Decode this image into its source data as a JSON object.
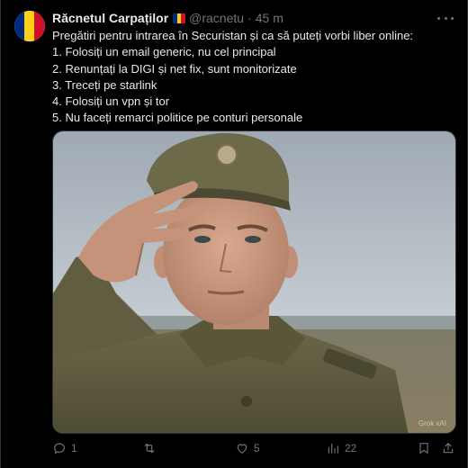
{
  "colors": {
    "flag_blue": "#002b7f",
    "flag_yellow": "#fcd116",
    "flag_red": "#ce1126",
    "text_primary": "#e7e9ea",
    "text_secondary": "#71767b",
    "background": "#000000"
  },
  "author": {
    "name": "Răcnetul Carpaților",
    "handle": "@racnetu",
    "separator": "·",
    "time": "45 m",
    "flag_icon": "romania-flag-icon"
  },
  "tweet": {
    "lines": [
      "Pregătiri pentru intrarea în Securistan și ca să puteți vorbi liber online:",
      "1. Folosiți un email generic, nu cel principal",
      "2. Renunțați la DIGI și net fix, sunt monitorizate",
      "3. Treceți pe starlink",
      "4. Folosiți un vpn și tor",
      "5. Nu faceți remarci politice pe conturi personale"
    ]
  },
  "media": {
    "watermark": "Grok xAI"
  },
  "actions": {
    "reply": {
      "icon": "reply-icon",
      "count": "1"
    },
    "repost": {
      "icon": "repost-icon",
      "count": ""
    },
    "like": {
      "icon": "like-icon",
      "count": "5"
    },
    "views": {
      "icon": "views-icon",
      "count": "22"
    },
    "bookmark": {
      "icon": "bookmark-icon"
    },
    "share": {
      "icon": "share-icon"
    }
  }
}
